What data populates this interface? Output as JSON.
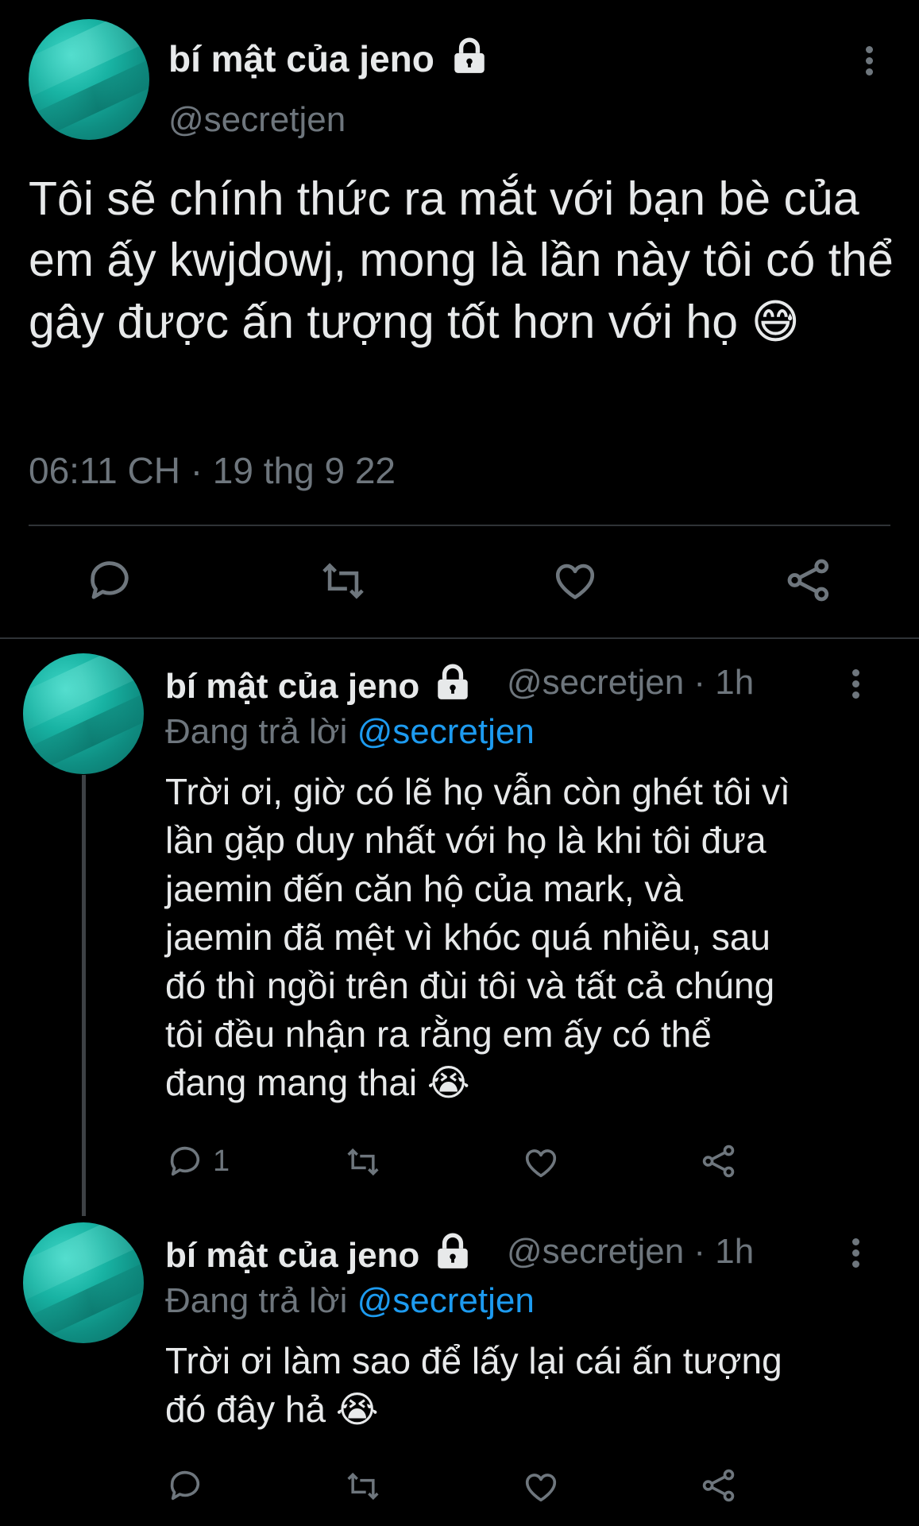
{
  "main_tweet": {
    "author_name": "bí mật của jeno",
    "handle": "@secretjen",
    "text": "Tôi sẽ chính thức ra mắt với bạn bè của em ấy kwjdowj, mong là lần này tôi có thể gây được ấn tượng tốt hơn với họ",
    "emoji": "😅",
    "timestamp": "06:11 CH · 19 thg 9 22",
    "icons": [
      "reply-icon",
      "retweet-icon",
      "like-icon",
      "share-icon"
    ]
  },
  "replies": [
    {
      "author_name": "bí mật của jeno",
      "handle_time": "@secretjen · 1h",
      "replying_label": "Đang trả lời",
      "replying_to": "@secretjen",
      "text_lines": [
        "Trời ơi, giờ có lẽ họ vẫn còn ghét tôi vì",
        "lần gặp duy nhất với họ là khi tôi đưa",
        "jaemin đến căn hộ của mark, và",
        "jaemin đã mệt vì khóc quá nhiều, sau",
        "đó thì ngồi trên đùi tôi và tất cả chúng",
        "tôi đều nhận ra rằng em ấy có thể",
        "đang mang thai"
      ],
      "emoji": "😭",
      "reply_count": "1"
    },
    {
      "author_name": "bí mật của jeno",
      "handle_time": "@secretjen · 1h",
      "replying_label": "Đang trả lời",
      "replying_to": "@secretjen",
      "text_lines": [
        "Trời ơi làm sao để lấy lại cái ấn tượng",
        "đó đây hả"
      ],
      "emoji": "😭",
      "reply_count": ""
    }
  ],
  "colors": {
    "background": "#000000",
    "text": "#e7e9ea",
    "secondary": "#6e767d",
    "link": "#1d9bf0",
    "divider": "#2f3336",
    "avatar": "#18b3a3"
  }
}
